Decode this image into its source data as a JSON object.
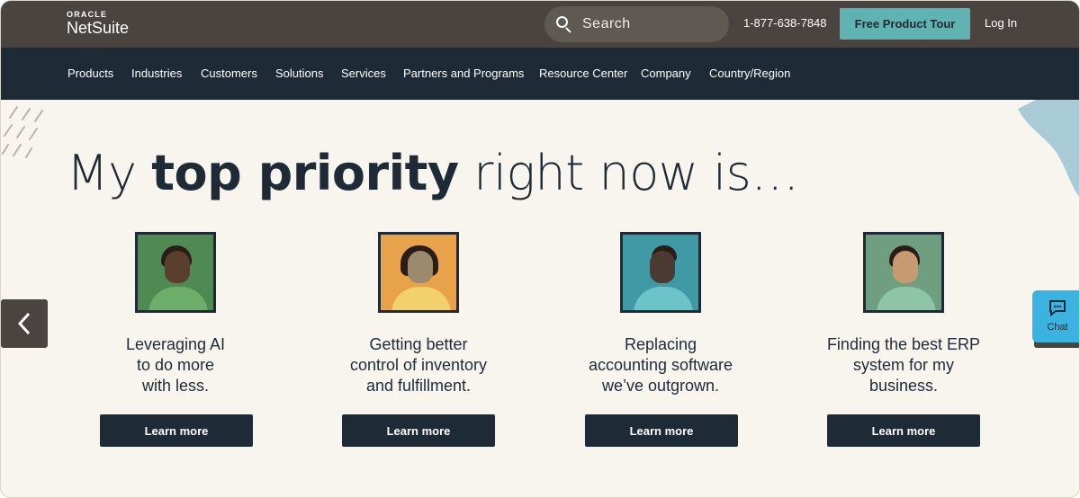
{
  "header": {
    "logo_top": "ORACLE",
    "logo_main": "NetSuite",
    "search_placeholder": "Search",
    "phone": "1-877-638-7848",
    "tour_label": "Free Product Tour",
    "login_label": "Log In"
  },
  "nav": {
    "items": [
      "Products",
      "Industries",
      "Customers",
      "Solutions",
      "Services",
      "Partners and Programs",
      "Resource Center",
      "Company",
      "Country/Region"
    ]
  },
  "hero": {
    "headline_pre": "My ",
    "headline_bold": "top priority",
    "headline_post": " right now is…",
    "cards": [
      {
        "lines": [
          "Leveraging AI",
          "to do more",
          "with less."
        ],
        "button": "Learn more"
      },
      {
        "lines": [
          "Getting better",
          "control of inventory",
          "and fulfillment."
        ],
        "button": "Learn more"
      },
      {
        "lines": [
          "Replacing",
          "accounting software",
          "we’ve outgrown."
        ],
        "button": "Learn more"
      },
      {
        "lines": [
          "Finding the best ERP",
          "system for my",
          "business."
        ],
        "button": "Learn more"
      }
    ]
  },
  "chat": {
    "label": "Chat"
  },
  "colors": {
    "topbar": "#4a4440",
    "nav": "#1e2a36",
    "accent": "#5fb3b3",
    "hero_bg": "#f8f5ef",
    "chat": "#3ab3e0"
  }
}
